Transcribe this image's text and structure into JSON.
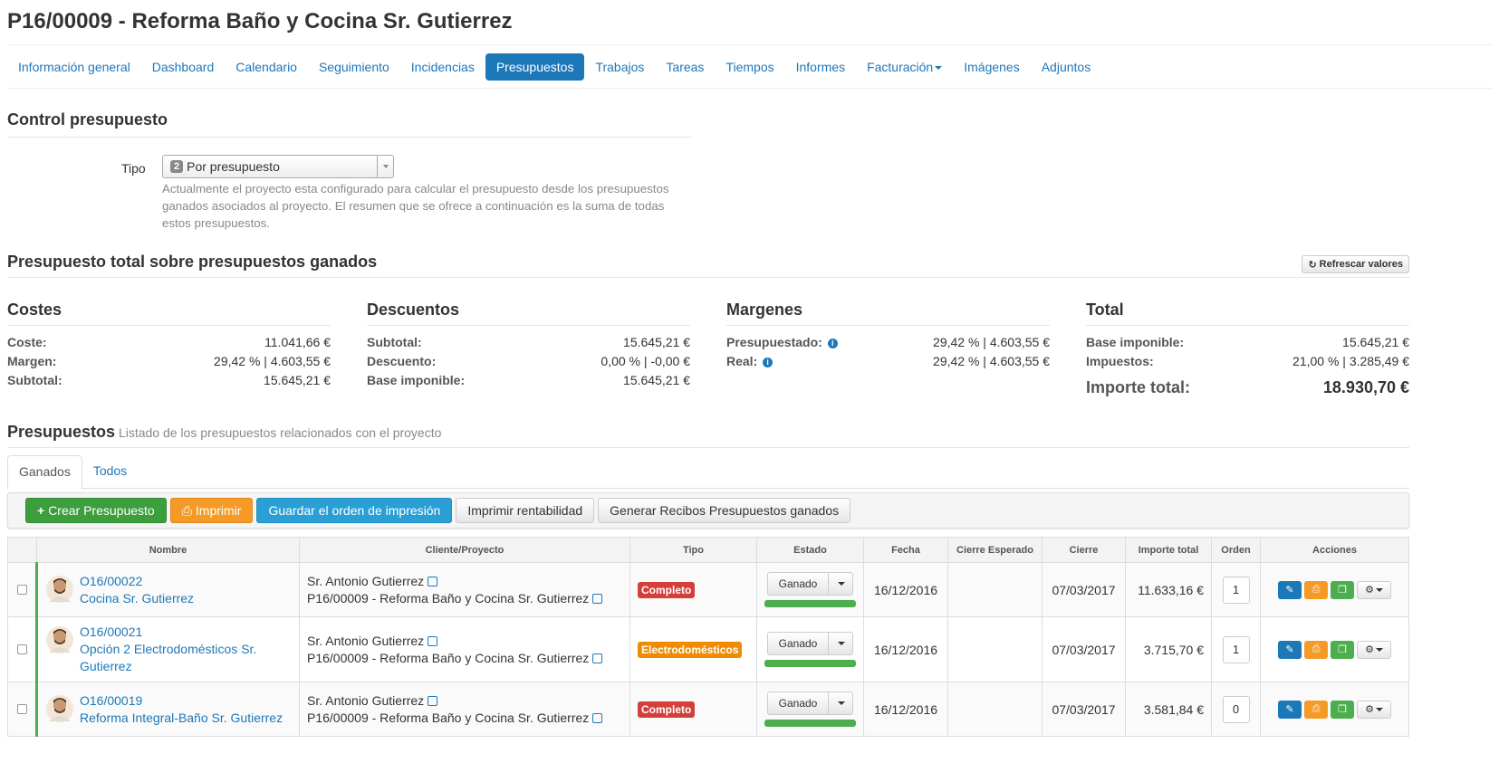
{
  "title": "P16/00009 - Reforma Baño y Cocina Sr. Gutierrez",
  "nav": [
    {
      "label": "Información general",
      "active": false
    },
    {
      "label": "Dashboard",
      "active": false
    },
    {
      "label": "Calendario",
      "active": false
    },
    {
      "label": "Seguimiento",
      "active": false
    },
    {
      "label": "Incidencias",
      "active": false
    },
    {
      "label": "Presupuestos",
      "active": true
    },
    {
      "label": "Trabajos",
      "active": false
    },
    {
      "label": "Tareas",
      "active": false
    },
    {
      "label": "Tiempos",
      "active": false
    },
    {
      "label": "Informes",
      "active": false
    },
    {
      "label": "Facturación",
      "active": false,
      "dropdown": true
    },
    {
      "label": "Imágenes",
      "active": false
    },
    {
      "label": "Adjuntos",
      "active": false
    }
  ],
  "control": {
    "heading": "Control presupuesto",
    "tipo_label": "Tipo",
    "tipo_num": "2",
    "tipo_value": "Por presupuesto",
    "help": "Actualmente el proyecto esta configurado para calcular el presupuesto desde los presupuestos ganados asociados al proyecto. El resumen que se ofrece a continuación es la suma de todas estos presupuestos."
  },
  "total": {
    "heading": "Presupuesto total sobre presupuestos ganados",
    "refresh_label": "Refrescar valores"
  },
  "summary": {
    "costes": {
      "title": "Costes",
      "rows": [
        {
          "k": "Coste:",
          "v": "11.041,66 €"
        },
        {
          "k": "Margen:",
          "v": "29,42 % | 4.603,55 €"
        },
        {
          "k": "Subtotal:",
          "v": "15.645,21 €"
        }
      ]
    },
    "descuentos": {
      "title": "Descuentos",
      "rows": [
        {
          "k": "Subtotal:",
          "v": "15.645,21 €"
        },
        {
          "k": "Descuento:",
          "v": "0,00 % | -0,00 €"
        },
        {
          "k": "Base imponible:",
          "v": "15.645,21 €"
        }
      ]
    },
    "margenes": {
      "title": "Margenes",
      "rows": [
        {
          "k": "Presupuestado:",
          "v": "29,42 % | 4.603,55 €"
        },
        {
          "k": "Real:",
          "v": "29,42 % | 4.603,55 €"
        }
      ]
    },
    "total": {
      "title": "Total",
      "rows": [
        {
          "k": "Base imponible:",
          "v": "15.645,21 €"
        },
        {
          "k": "Impuestos:",
          "v": "21,00 % | 3.285,49 €"
        }
      ],
      "big_k": "Importe total:",
      "big_v": "18.930,70 €"
    }
  },
  "presupuestos": {
    "heading": "Presupuestos",
    "subtitle": "Listado de los presupuestos relacionados con el proyecto",
    "tabs": [
      "Ganados",
      "Todos"
    ]
  },
  "toolbar": {
    "crear": "Crear Presupuesto",
    "imprimir": "Imprimir",
    "guardar": "Guardar el orden de impresión",
    "rentabilidad": "Imprimir rentabilidad",
    "recibos": "Generar Recibos Presupuestos ganados"
  },
  "table": {
    "headers": [
      "Nombre",
      "Cliente/Proyecto",
      "Tipo",
      "Estado",
      "Fecha",
      "Cierre Esperado",
      "Cierre",
      "Importe total",
      "Orden",
      "Acciones"
    ],
    "rows": [
      {
        "code": "O16/00022",
        "name": "Cocina Sr. Gutierrez",
        "cliente": "Sr. Antonio Gutierrez",
        "proyecto": "P16/00009 - Reforma Baño y Cocina Sr. Gutierrez",
        "tipo": "Completo",
        "estado": "Ganado",
        "fecha": "16/12/2016",
        "cierre_esperado": "",
        "cierre": "07/03/2017",
        "importe": "11.633,16 €",
        "orden": "1"
      },
      {
        "code": "O16/00021",
        "name": "Opción 2 Electrodomésticos Sr. Gutierrez",
        "cliente": "Sr. Antonio Gutierrez",
        "proyecto": "P16/00009 - Reforma Baño y Cocina Sr. Gutierrez",
        "tipo": "Electrodomésticos",
        "estado": "Ganado",
        "fecha": "16/12/2016",
        "cierre_esperado": "",
        "cierre": "07/03/2017",
        "importe": "3.715,70 €",
        "orden": "1"
      },
      {
        "code": "O16/00019",
        "name": "Reforma Integral-Baño Sr. Gutierrez",
        "cliente": "Sr. Antonio Gutierrez",
        "proyecto": "P16/00009 - Reforma Baño y Cocina Sr. Gutierrez",
        "tipo": "Completo",
        "estado": "Ganado",
        "fecha": "16/12/2016",
        "cierre_esperado": "",
        "cierre": "07/03/2017",
        "importe": "3.581,84 €",
        "orden": "0"
      }
    ]
  },
  "colors": {
    "link": "#1d78b8",
    "green": "#4cae4c",
    "orange": "#f59a26",
    "red": "#d43f3a"
  }
}
